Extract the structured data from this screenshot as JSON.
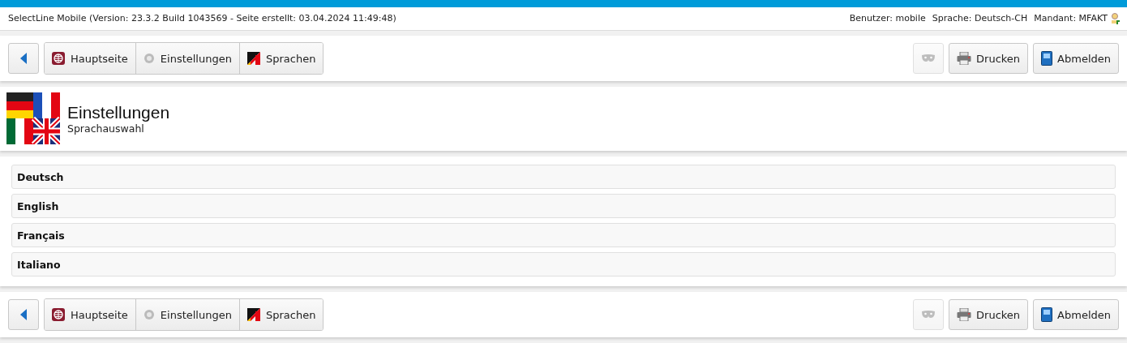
{
  "header": {
    "app_info": "SelectLine Mobile (Version: 23.3.2 Build 1043569 - Seite erstellt: 03.04.2024 11:49:48)",
    "user": "Benutzer: mobile",
    "language": "Sprache: Deutsch-CH",
    "client": "Mandant: MFAKT"
  },
  "toolbars": [
    {
      "nav": [
        {
          "kind": "home",
          "label": "Hauptseite"
        },
        {
          "kind": "gear",
          "label": "Einstellungen"
        },
        {
          "kind": "flag",
          "label": "Sprachen"
        }
      ],
      "actions": [
        {
          "kind": "mask",
          "disabled": true
        },
        {
          "kind": "print",
          "label": "Drucken",
          "disabled": false
        },
        {
          "kind": "logout",
          "label": "Abmelden",
          "disabled": false
        }
      ]
    },
    {
      "nav": [
        {
          "kind": "home",
          "label": "Hauptseite"
        },
        {
          "kind": "gear",
          "label": "Einstellungen"
        },
        {
          "kind": "flag",
          "label": "Sprachen"
        }
      ],
      "actions": [
        {
          "kind": "mask",
          "disabled": true
        },
        {
          "kind": "print",
          "label": "Drucken",
          "disabled": false
        },
        {
          "kind": "logout",
          "label": "Abmelden",
          "disabled": false
        }
      ]
    }
  ],
  "page": {
    "title": "Einstellungen",
    "subtitle": "Sprachauswahl"
  },
  "languages": [
    "Deutsch",
    "English",
    "Français",
    "Italiano"
  ]
}
